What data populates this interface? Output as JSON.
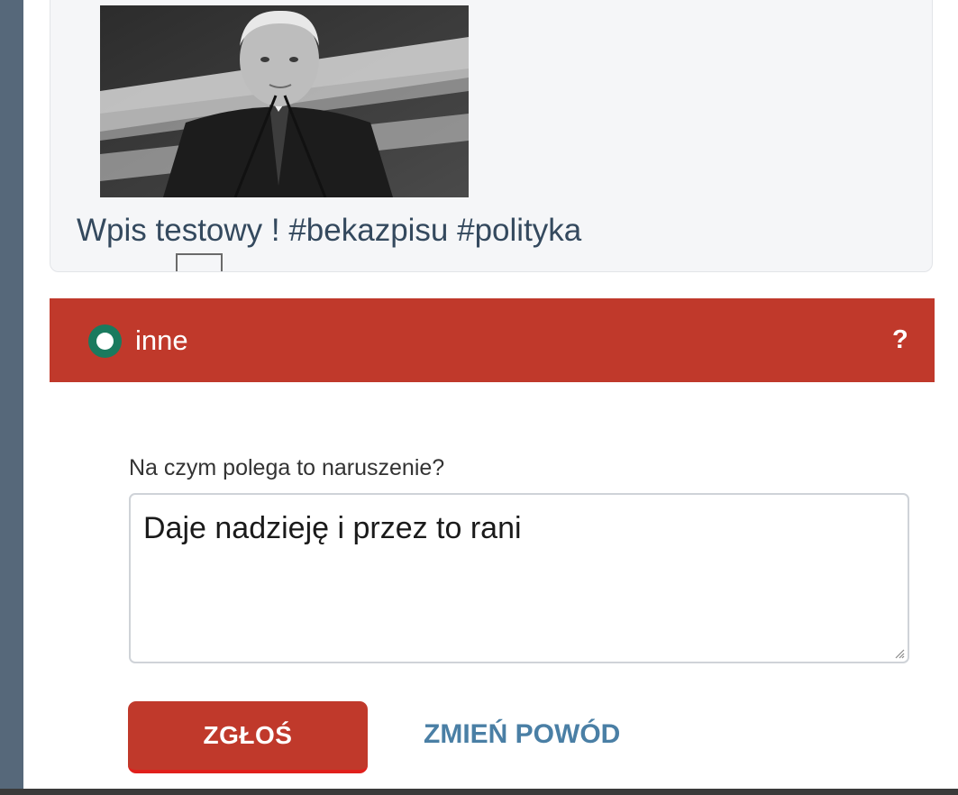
{
  "post": {
    "image_alt": "man at podium black-and-white photo",
    "text": "Wpis testowy ! #bekazpisu #polityka"
  },
  "report": {
    "selected_reason": "inne",
    "help_label": "?",
    "question_label": "Na czym polega to naruszenie?",
    "description_value": "Daje nadzieję i przez to rani",
    "submit_label": "ZGŁOŚ",
    "change_reason_label": "ZMIEŃ POWÓD"
  },
  "colors": {
    "accent_red": "#c0392b",
    "radio_green": "#1a7a5e",
    "link_blue": "#4a7fa5",
    "rail": "#56687a"
  }
}
